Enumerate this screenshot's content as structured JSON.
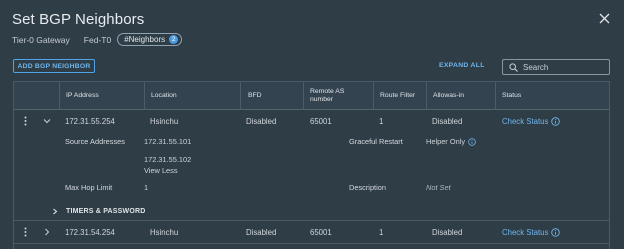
{
  "dialog": {
    "title": "Set BGP Neighbors",
    "gateway_label": "Tier-0 Gateway",
    "gateway_value": "Fed-T0",
    "neighbors_tag": "#Neighbors",
    "neighbors_count": "2"
  },
  "toolbar": {
    "add_button": "ADD BGP NEIGHBOR",
    "expand_all": "EXPAND ALL",
    "search_placeholder": "Search"
  },
  "table": {
    "headers": [
      "IP Address",
      "Location",
      "BFD",
      "Remote AS number",
      "Route Filter",
      "Allowas-in",
      "Status"
    ],
    "rows": [
      {
        "ip": "172.31.55.254",
        "location": "Hsinchu",
        "bfd": "Disabled",
        "remote_as": "65001",
        "route_filter": "1",
        "allowas_in": "Disabled",
        "status": "Check Status"
      },
      {
        "ip": "172.31.54.254",
        "location": "Hsinchu",
        "bfd": "Disabled",
        "remote_as": "65001",
        "route_filter": "1",
        "allowas_in": "Disabled",
        "status": "Check Status"
      }
    ],
    "detail": {
      "source_addresses_label": "Source Addresses",
      "source_address_1": "172.31.55.101",
      "source_address_2": "172.31.55.102",
      "view_less": "View Less",
      "graceful_restart_label": "Graceful Restart",
      "graceful_restart_value": "Helper Only",
      "max_hop_label": "Max Hop Limit",
      "max_hop_value": "1",
      "description_label": "Description",
      "description_value": "Not Set",
      "timers_label": "TIMERS & PASSWORD"
    }
  },
  "colors": {
    "background": "#2f3d47",
    "accent": "#6fb6ee",
    "header_bg": "#334350"
  }
}
